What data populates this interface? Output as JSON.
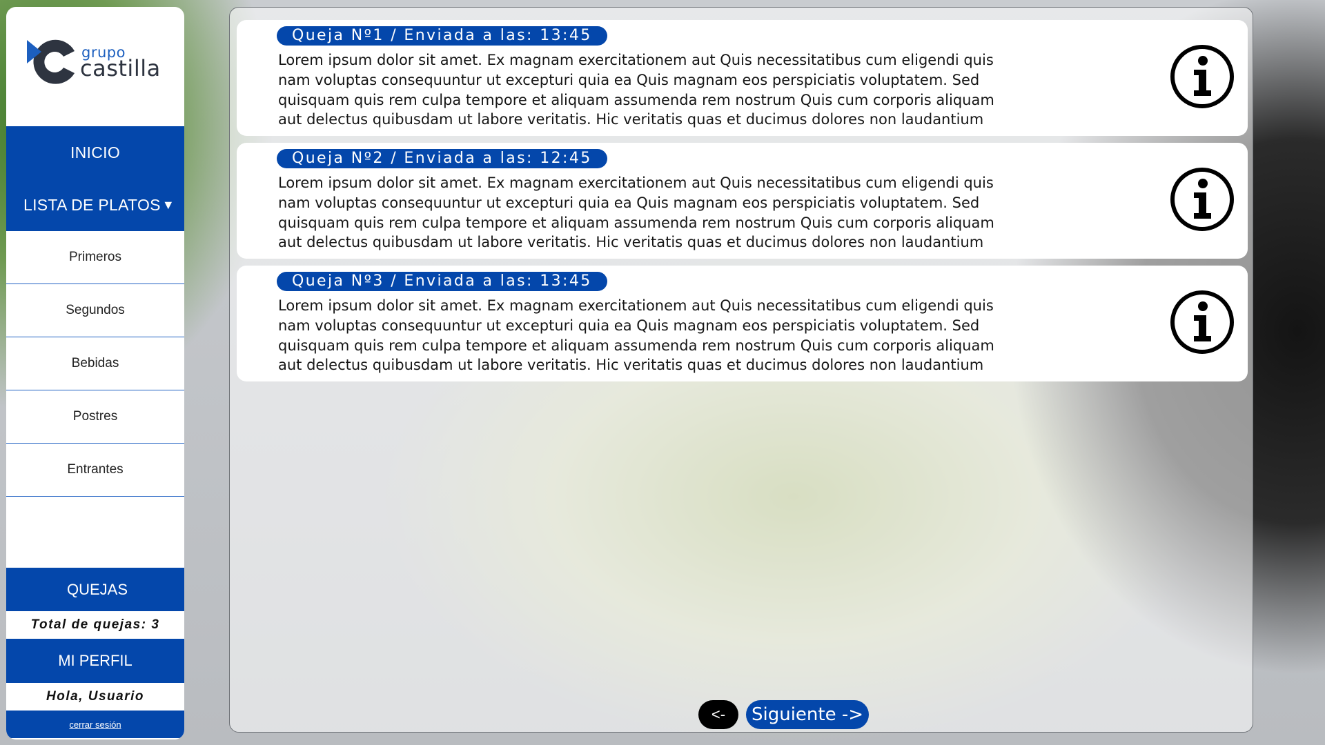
{
  "brand": {
    "line1": "grupo",
    "line2": "castilla"
  },
  "sidebar": {
    "inicio": "INICIO",
    "lista_platos": "LISTA DE PLATOS",
    "lista_caret": "▼",
    "items": [
      {
        "label": "Primeros"
      },
      {
        "label": "Segundos"
      },
      {
        "label": "Bebidas"
      },
      {
        "label": "Postres"
      },
      {
        "label": "Entrantes"
      }
    ],
    "quejas": "QUEJAS",
    "total_quejas": "Total de quejas: 3",
    "mi_perfil": "MI PERFIL",
    "greeting": "Hola, Usuario",
    "logout": "cerrar sesión"
  },
  "complaints": [
    {
      "title": "Queja Nº1 / Enviada a las: 13:45",
      "body": "Lorem ipsum dolor sit amet. Ex magnam exercitationem aut Quis necessitatibus cum eligendi quis nam voluptas consequuntur ut excepturi quia ea Quis magnam eos perspiciatis voluptatem. Sed quisquam quis rem culpa tempore et aliquam assumenda rem nostrum Quis cum corporis aliquam aut delectus quibusdam ut labore veritatis. Hic veritatis quas et ducimus dolores non laudantium distinctio ut exercitationem..."
    },
    {
      "title": "Queja Nº2 / Enviada a las: 12:45",
      "body": "Lorem ipsum dolor sit amet. Ex magnam exercitationem aut Quis necessitatibus cum eligendi quis nam voluptas consequuntur ut excepturi quia ea Quis magnam eos perspiciatis voluptatem. Sed quisquam quis rem culpa tempore et aliquam assumenda rem nostrum Quis cum corporis aliquam aut delectus quibusdam ut labore veritatis. Hic veritatis quas et ducimus dolores non laudantium distinctio ut exercitationem..."
    },
    {
      "title": "Queja Nº3 / Enviada a las: 13:45",
      "body": "Lorem ipsum dolor sit amet. Ex magnam exercitationem aut Quis necessitatibus cum eligendi quis nam voluptas consequuntur ut excepturi quia ea Quis magnam eos perspiciatis voluptatem. Sed quisquam quis rem culpa tempore et aliquam assumenda rem nostrum Quis cum corporis aliquam aut delectus quibusdam ut labore veritatis. Hic veritatis quas et ducimus dolores non laudantium distinctio ut exercitationem..."
    }
  ],
  "pager": {
    "prev": "<-",
    "next": "Siguiente ->"
  },
  "colors": {
    "primary": "#0447ab",
    "white": "#ffffff",
    "black": "#000000"
  },
  "icons": {
    "info": "info-circle-icon",
    "logo": "grupo-castilla-logo"
  }
}
